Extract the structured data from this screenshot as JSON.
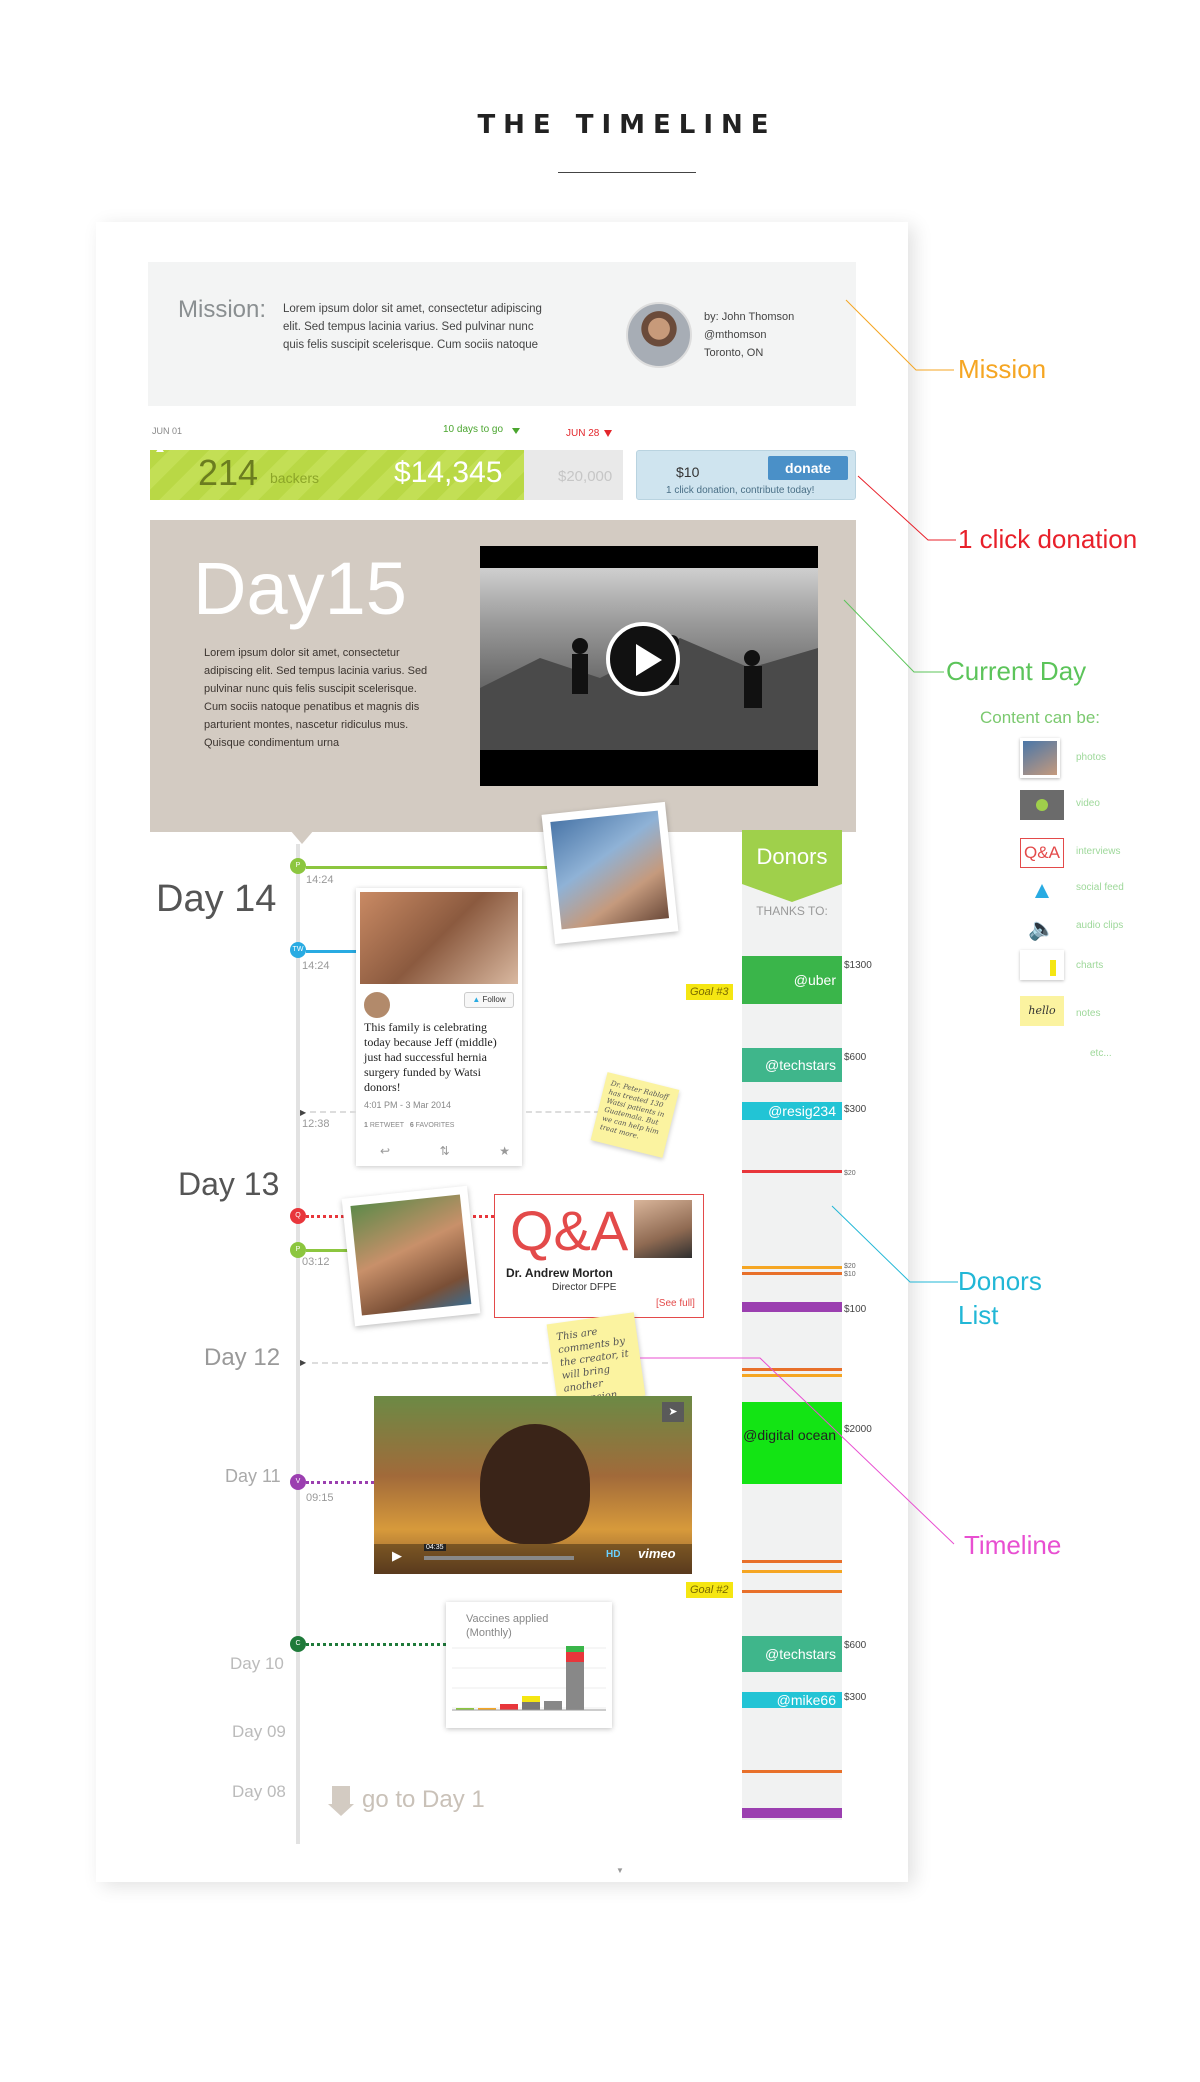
{
  "header": {
    "title": "THE TIMELINE"
  },
  "mission": {
    "label": "Mission:",
    "text": "Lorem ipsum dolor sit amet, consectetur adipiscing elit. Sed tempus lacinia varius. Sed pulvinar nunc quis felis suscipit scelerisque. Cum sociis natoque",
    "author": "by: John Thomson",
    "handle": "@mthomson",
    "location": "Toronto, ON"
  },
  "funding": {
    "start_date": "JUN 01",
    "days_left": "10 days to go",
    "end_date": "JUN 28",
    "backers_count": "214",
    "backers_label": "backers",
    "raised": "$14,345",
    "goal": "$20,000",
    "progress_fraction": 0.72,
    "donate_amount": "$10",
    "donate_button": "donate",
    "donate_note": "1 click donation, contribute today!"
  },
  "current_day": {
    "title": "Day15",
    "text": "Lorem ipsum dolor sit amet, consectetur adipiscing elit. Sed tempus lacinia varius. Sed pulvinar nunc quis felis suscipit scelerisque. Cum sociis natoque penatibus et magnis dis parturient montes, nascetur ridiculus mus. Quisque condimentum urna"
  },
  "timeline": {
    "day14": "Day 14",
    "day13": "Day 13",
    "day12": "Day 12",
    "day11": "Day 11",
    "day10": "Day 10",
    "day09": "Day 09",
    "day08": "Day 08",
    "go_to_day1": "go to Day 1",
    "times": [
      "14:24",
      "14:24",
      "12:38",
      "03:12",
      "09:15"
    ],
    "dot_labels": [
      "P",
      "TW",
      "Q",
      "P",
      "V",
      "C"
    ],
    "tweet": {
      "follow": "Follow",
      "text": "This family is celebrating today because Jeff (middle) just had successful hernia surgery funded by Watsi donors!",
      "date": "4:01 PM - 3 Mar 2014",
      "retweets": "1",
      "retweets_label": "RETWEET",
      "favorites": "6",
      "favorites_label": "FAVORITES"
    },
    "sticky1": "Dr. Peter Rabloff has treated 130 Watsi patients in Guatemala. But we can help him treat more.",
    "sticky2": "This are comments by the creator, it will bring another dimension.",
    "qa": {
      "title": "Q&A",
      "name": "Dr. Andrew Morton",
      "role": "Director DFPE",
      "link": "[See full]"
    },
    "video2": {
      "time": "04:35",
      "brand": "vimeo",
      "hd": "HD"
    },
    "chart_title": "Vaccines applied (Monthly)"
  },
  "donors": {
    "title": "Donors",
    "thanks": "THANKS TO:",
    "goal3": "Goal #3",
    "goal2": "Goal #2",
    "entries": [
      {
        "name": "@uber",
        "amount": "$1300",
        "color": "#3ab54a"
      },
      {
        "name": "@techstars",
        "amount": "$600",
        "color": "#3fb68b"
      },
      {
        "name": "@resig234",
        "amount": "$300",
        "color": "#22c4d5"
      },
      {
        "name": "@digital ocean",
        "amount": "$2000",
        "color": "#13e414"
      },
      {
        "name": "@techstars",
        "amount": "$600",
        "color": "#3fb68b"
      },
      {
        "name": "@mike66",
        "amount": "$300",
        "color": "#22c4d5"
      }
    ],
    "small_amounts": [
      "$20",
      "$20",
      "$10",
      "$100"
    ]
  },
  "annotations": {
    "mission": "Mission",
    "donation": "1 click donation",
    "current_day": "Current Day",
    "donors_list": "Donors\nList",
    "timeline": "Timeline",
    "colors": {
      "mission": "#f5a623",
      "donation": "#e8202a",
      "current_day": "#5cc45a",
      "donors": "#22b7d6",
      "timeline": "#e84fd1"
    }
  },
  "legend": {
    "heading": "Content can be:",
    "items": [
      "photos",
      "video",
      "interviews",
      "social feed",
      "audio clips",
      "charts",
      "notes",
      "etc..."
    ],
    "qa_icon": "Q&A",
    "note_icon": "hello"
  }
}
